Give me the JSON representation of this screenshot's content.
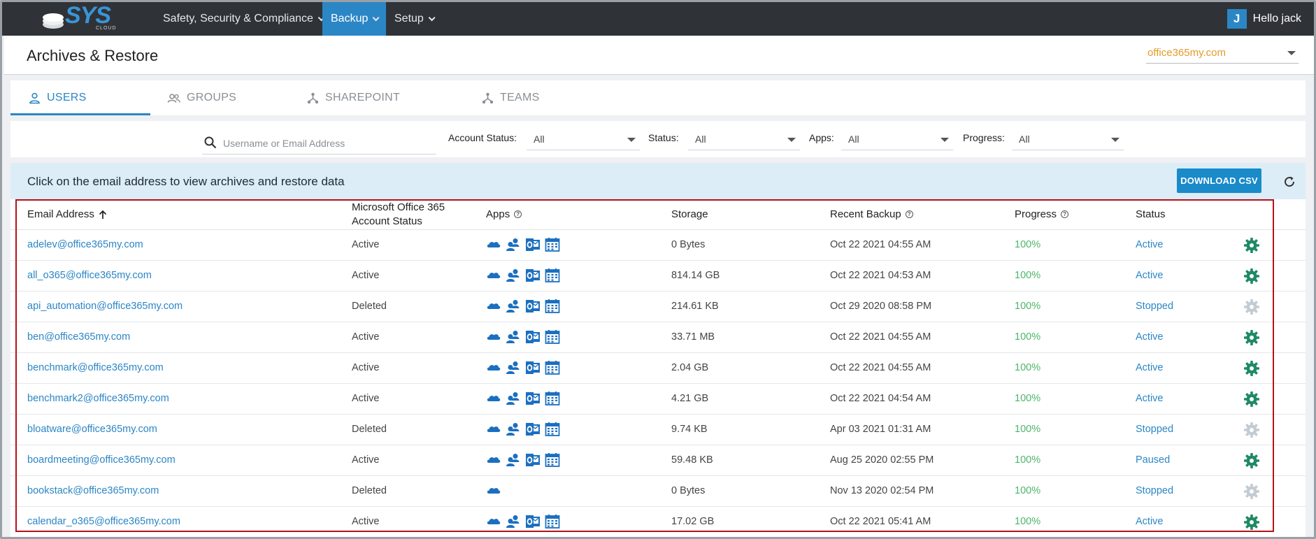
{
  "nav": {
    "logo_text": "SYS",
    "logo_sub": "CLOUD",
    "items": [
      {
        "label": "Safety, Security & Compliance"
      },
      {
        "label": "Backup"
      },
      {
        "label": "Setup"
      }
    ],
    "user_initial": "J",
    "greeting": "Hello jack"
  },
  "header": {
    "title": "Archives & Restore",
    "tenant": "office365my.com"
  },
  "tabs": [
    {
      "label": "USERS"
    },
    {
      "label": "GROUPS"
    },
    {
      "label": "SHAREPOINT"
    },
    {
      "label": "TEAMS"
    }
  ],
  "filters": {
    "search_placeholder": "Username or Email Address",
    "account_status_label": "Account Status:",
    "account_status_value": "All",
    "status_label": "Status:",
    "status_value": "All",
    "apps_label": "Apps:",
    "apps_value": "All",
    "progress_label": "Progress:",
    "progress_value": "All"
  },
  "banner": {
    "text": "Click on the email address to view archives and restore data",
    "download_label": "DOWNLOAD CSV"
  },
  "table": {
    "columns": {
      "email": "Email Address",
      "account_status_line1": "Microsoft Office 365",
      "account_status_line2": "Account Status",
      "apps": "Apps",
      "storage": "Storage",
      "recent_backup": "Recent Backup",
      "progress": "Progress",
      "status": "Status"
    },
    "rows": [
      {
        "email": "adelev@office365my.com",
        "account": "Active",
        "apps": [
          "onedrive",
          "contacts",
          "outlook",
          "calendar"
        ],
        "storage": "0 Bytes",
        "backup": "Oct 22 2021 04:55 AM",
        "progress": "100%",
        "status": "Active",
        "gear_color": "#1f8a64"
      },
      {
        "email": "all_o365@office365my.com",
        "account": "Active",
        "apps": [
          "onedrive",
          "contacts",
          "outlook",
          "calendar"
        ],
        "storage": "814.14 GB",
        "backup": "Oct 22 2021 04:53 AM",
        "progress": "100%",
        "status": "Active",
        "gear_color": "#1f8a64"
      },
      {
        "email": "api_automation@office365my.com",
        "account": "Deleted",
        "apps": [
          "onedrive",
          "contacts",
          "outlook",
          "calendar"
        ],
        "storage": "214.61 KB",
        "backup": "Oct 29 2020 08:58 PM",
        "progress": "100%",
        "status": "Stopped",
        "gear_color": "#c3cbd3"
      },
      {
        "email": "ben@office365my.com",
        "account": "Active",
        "apps": [
          "onedrive",
          "contacts",
          "outlook",
          "calendar"
        ],
        "storage": "33.71 MB",
        "backup": "Oct 22 2021 04:55 AM",
        "progress": "100%",
        "status": "Active",
        "gear_color": "#1f8a64"
      },
      {
        "email": "benchmark@office365my.com",
        "account": "Active",
        "apps": [
          "onedrive",
          "contacts",
          "outlook",
          "calendar"
        ],
        "storage": "2.04 GB",
        "backup": "Oct 22 2021 04:55 AM",
        "progress": "100%",
        "status": "Active",
        "gear_color": "#1f8a64"
      },
      {
        "email": "benchmark2@office365my.com",
        "account": "Active",
        "apps": [
          "onedrive",
          "contacts",
          "outlook",
          "calendar"
        ],
        "storage": "4.21 GB",
        "backup": "Oct 22 2021 04:54 AM",
        "progress": "100%",
        "status": "Active",
        "gear_color": "#1f8a64"
      },
      {
        "email": "bloatware@office365my.com",
        "account": "Deleted",
        "apps": [
          "onedrive",
          "contacts",
          "outlook",
          "calendar"
        ],
        "storage": "9.74 KB",
        "backup": "Apr 03 2021 01:31 AM",
        "progress": "100%",
        "status": "Stopped",
        "gear_color": "#c3cbd3"
      },
      {
        "email": "boardmeeting@office365my.com",
        "account": "Active",
        "apps": [
          "onedrive",
          "contacts",
          "outlook",
          "calendar"
        ],
        "storage": "59.48 KB",
        "backup": "Aug 25 2020 02:55 PM",
        "progress": "100%",
        "status": "Paused",
        "gear_color": "#1f8a64"
      },
      {
        "email": "bookstack@office365my.com",
        "account": "Deleted",
        "apps": [
          "onedrive"
        ],
        "storage": "0 Bytes",
        "backup": "Nov 13 2020 02:54 PM",
        "progress": "100%",
        "status": "Stopped",
        "gear_color": "#c3cbd3"
      },
      {
        "email": "calendar_o365@office365my.com",
        "account": "Active",
        "apps": [
          "onedrive",
          "contacts",
          "outlook",
          "calendar"
        ],
        "storage": "17.02 GB",
        "backup": "Oct 22 2021 05:41 AM",
        "progress": "100%",
        "status": "Active",
        "gear_color": "#1f8a64"
      }
    ]
  }
}
